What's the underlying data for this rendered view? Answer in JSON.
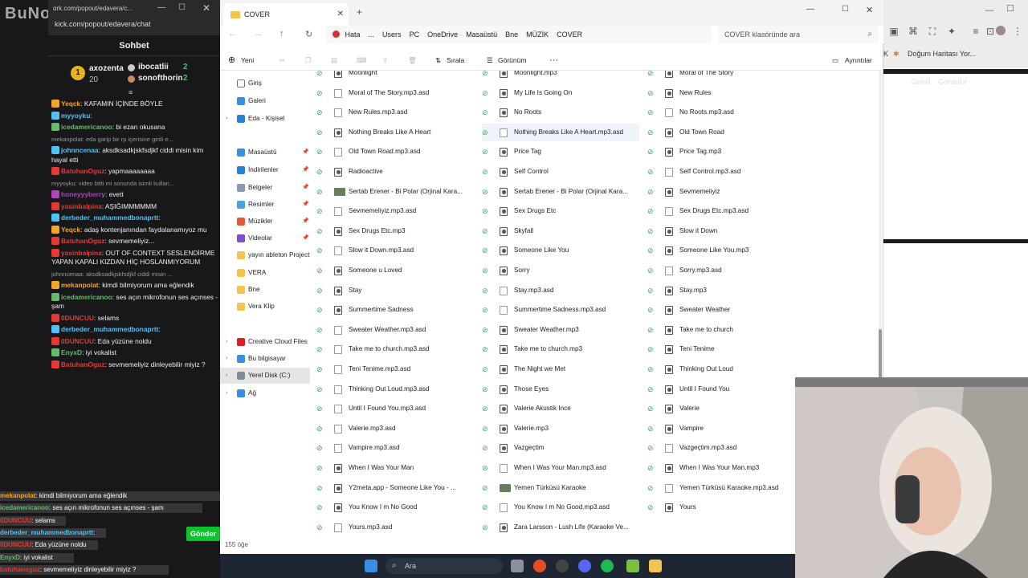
{
  "background_browser": {
    "bookmark": "Doğum Haritası Yor...",
    "google_links": [
      "Gmail",
      "Görseller"
    ]
  },
  "chat": {
    "logo": "BuNoGame",
    "url": "kick.com/popout/edavera/chat",
    "url_short": "ɑrk.com/popout/edavera/c...",
    "header": "Sohbet",
    "leaderboard": [
      {
        "name": "axozenta",
        "value": "20"
      },
      {
        "name": "ibocatlii",
        "value": "2"
      },
      {
        "name": "sonofthorin",
        "value": "2"
      }
    ],
    "messages": [
      {
        "user": "Yeqck",
        "text": ": KAFAMIN İÇİNDE BÖYLE",
        "color": "#f5a623"
      },
      {
        "user": "myyoyku",
        "text": ":",
        "color": "#4fc3f7"
      },
      {
        "user": "icedamericanoo",
        "text": ": bi ezan okusana",
        "color": "#66bb6a"
      },
      {
        "reply": "mekanpolat: eda garip bir rp içerisine girdi e..."
      },
      {
        "user": "johnncenaa",
        "text": ": aksdksadkjskfsdjkf ciddi misin kim hayal etti",
        "color": "#4fc3f7"
      },
      {
        "user": "BatuhanOguz",
        "text": ": yapmaaaaaaaa",
        "color": "#e53935"
      },
      {
        "reply": "myyoyku: video bitti mi sonunda isimli kullan..."
      },
      {
        "user": "honeyyyberry",
        "text": ": evett",
        "color": "#ab47bc"
      },
      {
        "user": "yasinbalpina",
        "text": ": AŞIĞIMMMMMM",
        "color": "#e53935"
      },
      {
        "user": "derbeder_muhammedbonaprtt",
        "text": ":",
        "color": "#4fc3f7"
      },
      {
        "user": "Yeqck",
        "text": ": adaş kontenjanından faydalanamıyoz mu",
        "color": "#f5a623"
      },
      {
        "user": "BatuhanOguz",
        "text": ": sevmemeliyiz...",
        "color": "#e53935"
      },
      {
        "user": "yasinbalpina",
        "text": ": OUT OF CONTEXT SESLENDİRME YAPAN KAPALI KIZDAN HİÇ HOSLANMIYORUM",
        "color": "#e53935"
      },
      {
        "reply": "johnncenaa: aksdksadkjskfsdjkf ciddi misin ..."
      },
      {
        "user": "mekanpolat",
        "text": ": kimdi bilmiyorum ama eğlendik",
        "color": "#f5a623"
      },
      {
        "user": "icedamericanoo",
        "text": ": ses açın mikrofonun ses açınses - şam",
        "color": "#66bb6a"
      },
      {
        "user": "0DUNCUU",
        "text": ": selams",
        "color": "#e53935"
      },
      {
        "user": "derbeder_muhammedbonaprtt",
        "text": ":",
        "color": "#4fc3f7"
      },
      {
        "user": "0DUNCUU",
        "text": ": Eda yüzüne noldu",
        "color": "#e53935"
      },
      {
        "user": "EnyxD",
        "text": ": iyi vokalist",
        "color": "#66bb6a"
      },
      {
        "user": "BatuhanOguz",
        "text": ": sevmemeliyiz dinleyebilir miyiz ?",
        "color": "#e53935"
      }
    ],
    "overlay": [
      {
        "user": "mekanpolat",
        "text": ": kimdi bilmiyorum ama eğlendik"
      },
      {
        "user": "icedamericanoo",
        "text": ": ses açın mikrofonun ses açınses - şam"
      },
      {
        "user": "0DUNCUU",
        "text": ": selams"
      },
      {
        "user": "derbeder_muhammedbonaprtt",
        "text": ":"
      },
      {
        "user": "0DUNCUU",
        "text": ": Eda yüzüne noldu"
      },
      {
        "user": "EnyxD",
        "text": ": iyi vokalist"
      },
      {
        "user": "batuhanoguz",
        "text": ": sevmemeliyiz dinleyebilir miyiz ?"
      }
    ],
    "send_label": "Gönder"
  },
  "explorer": {
    "tab_title": "COVER",
    "breadcrumb": [
      "Hata",
      "...",
      "Users",
      "PC",
      "OneDrive",
      "Masaüstü",
      "Bne",
      "MÜZİK",
      "COVER"
    ],
    "search_placeholder": "COVER klasöründe ara",
    "toolbar": {
      "new": "Yeni",
      "sort": "Sırala",
      "view": "Görünüm",
      "more": "···",
      "details": "Ayrıntılar"
    },
    "nav": [
      {
        "label": "Giriş",
        "icon": "home-icon"
      },
      {
        "label": "Galeri",
        "icon": "gallery-icon"
      },
      {
        "label": "Eda - Kişisel",
        "icon": "cloud-icon",
        "arrow": true
      },
      {
        "label": "Masaüstü",
        "icon": "desktop-icon",
        "pin": true
      },
      {
        "label": "İndirilenler",
        "icon": "download-icon",
        "pin": true
      },
      {
        "label": "Belgeler",
        "icon": "documents-icon",
        "pin": true
      },
      {
        "label": "Resimler",
        "icon": "pictures-icon",
        "pin": true
      },
      {
        "label": "Müzikler",
        "icon": "music-icon",
        "pin": true
      },
      {
        "label": "Videolar",
        "icon": "videos-icon",
        "pin": true
      },
      {
        "label": "yayın ableton Project",
        "icon": "folder-icon"
      },
      {
        "label": "VERA",
        "icon": "folder-icon"
      },
      {
        "label": "Bne",
        "icon": "folder-icon"
      },
      {
        "label": "Vera Klip",
        "icon": "folder-icon"
      },
      {
        "label": "Creative Cloud Files",
        "icon": "creative-cloud-icon",
        "arrow": true
      },
      {
        "label": "Bu bilgisayar",
        "icon": "computer-icon",
        "arrow": true
      },
      {
        "label": "Yerel Disk (C:)",
        "icon": "disk-icon",
        "arrow": true,
        "selected": true
      },
      {
        "label": "Ağ",
        "icon": "network-icon",
        "arrow": true
      }
    ],
    "files": [
      [
        "Moonlight",
        "Moonlight.mp3",
        "Moral of The Story"
      ],
      [
        "Moral of The Story.mp3.asd",
        "My Life Is Going On",
        "New Rules"
      ],
      [
        "New Rules.mp3.asd",
        "No Roots",
        "No Roots.mp3.asd"
      ],
      [
        "Nothing Breaks Like A Heart",
        "Nothing Breaks Like A Heart.mp3.asd",
        "Old Town Road"
      ],
      [
        "Old Town Road.mp3.asd",
        "Price Tag",
        "Price Tag.mp3"
      ],
      [
        "Radioactive",
        "Self Control",
        "Self Control.mp3.asd"
      ],
      [
        "Sertab Erener - Bi Polar (Orjinal Kara...",
        "Sertab Erener - Bi Polar (Orjinal Kara...",
        "Sevmemeliyiz"
      ],
      [
        "Sevmemeliyiz.mp3.asd",
        "Sex Drugs Etc",
        "Sex Drugs Etc.mp3.asd"
      ],
      [
        "Sex Drugs Etc.mp3",
        "Skyfall",
        "Slow it Down"
      ],
      [
        "Slow it Down.mp3.asd",
        "Someone Like You",
        "Someone Like You.mp3"
      ],
      [
        "Someone u Loved",
        "Sorry",
        "Sorry.mp3.asd"
      ],
      [
        "Stay",
        "Stay.mp3.asd",
        "Stay.mp3"
      ],
      [
        "Summertime Sadness",
        "Summertime Sadness.mp3.asd",
        "Sweater Weather"
      ],
      [
        "Sweater Weather.mp3.asd",
        "Sweater Weather.mp3",
        "Take me to church"
      ],
      [
        "Take me to church.mp3.asd",
        "Take me to church.mp3",
        "Teni Tenime"
      ],
      [
        "Teni Tenime.mp3.asd",
        "The Night we Met",
        "Thinking Out Loud"
      ],
      [
        "Thinking Out Loud.mp3.asd",
        "Those Eyes",
        "Until I Found You"
      ],
      [
        "Until I Found You.mp3.asd",
        "Valerie Akustik Ince",
        "Valerie"
      ],
      [
        "Valerie.mp3.asd",
        "Valerie.mp3",
        "Vampire"
      ],
      [
        "Vampire.mp3.asd",
        "Vazgeçtim",
        "Vazgeçtim.mp3.asd"
      ],
      [
        "When I Was Your Man",
        "When I Was Your Man.mp3.asd",
        "When I Was Your Man.mp3"
      ],
      [
        "Y2meta.app - Someone Like You - ...",
        "Yemen Türküsü Karaoke",
        "Yemen Türküsü Karaoke.mp3.asd"
      ],
      [
        "You Know I m No Good",
        "You Know I m No Good.mp3.asd",
        "Yours"
      ],
      [
        "Yours.mp3.asd",
        "Zara Larsson - Lush Life (Karaoke Ve...",
        ""
      ]
    ],
    "status": "155 öğe"
  },
  "taskbar": {
    "search_placeholder": "Ara"
  }
}
